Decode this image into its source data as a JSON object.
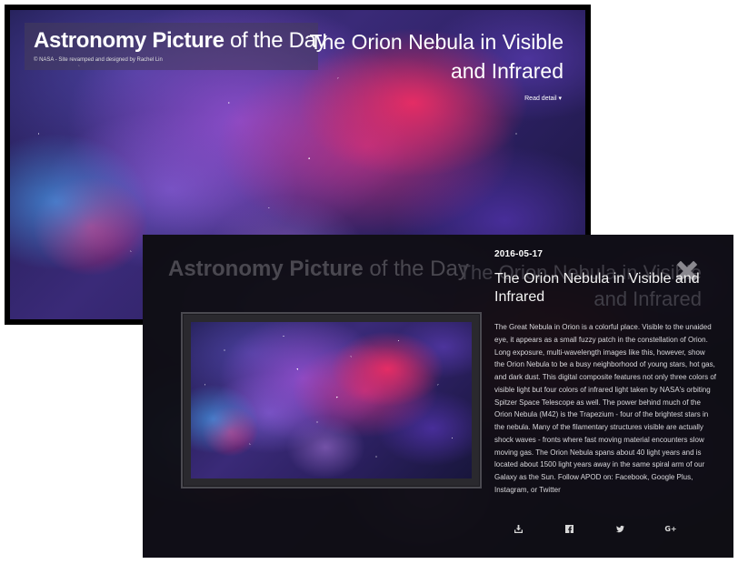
{
  "site": {
    "title_bold": "Astronomy Picture",
    "title_light": "of the Day",
    "credit": "© NASA - Site revamped and designed by Rachel Lin"
  },
  "hero": {
    "heading": "The Orion Nebula in Visible and Infrared",
    "read_detail_label": "Read detail ▾"
  },
  "detail": {
    "date": "2016-05-17",
    "heading": "The Orion Nebula in Visible and Infrared",
    "body": "The Great Nebula in Orion is a colorful place. Visible to the unaided eye, it appears as a small fuzzy patch in the constellation of Orion. Long exposure, multi-wavelength images like this, however, show the Orion Nebula to be a busy neighborhood of young stars, hot gas, and dark dust. This digital composite features not only three colors of visible light but four colors of infrared light taken by NASA's orbiting Spitzer Space Telescope as well. The power behind much of the Orion Nebula (M42) is the Trapezium - four of the brightest stars in the nebula. Many of the filamentary structures visible are actually shock waves - fronts where fast moving material encounters slow moving gas. The Orion Nebula spans about 40 light years and is located about 1500 light years away in the same spiral arm of our Galaxy as the Sun. Follow APOD on: Facebook, Google Plus, Instagram, or Twitter"
  },
  "share": {
    "icons": [
      "download-icon",
      "facebook-icon",
      "twitter-icon",
      "google-plus-icon"
    ],
    "google_plus_label": "G+"
  },
  "colors": {
    "nebula_magenta": "#eb2d64",
    "nebula_violet": "#9650d2",
    "nebula_blue": "#4696e6",
    "panel_dark": "#121115"
  }
}
